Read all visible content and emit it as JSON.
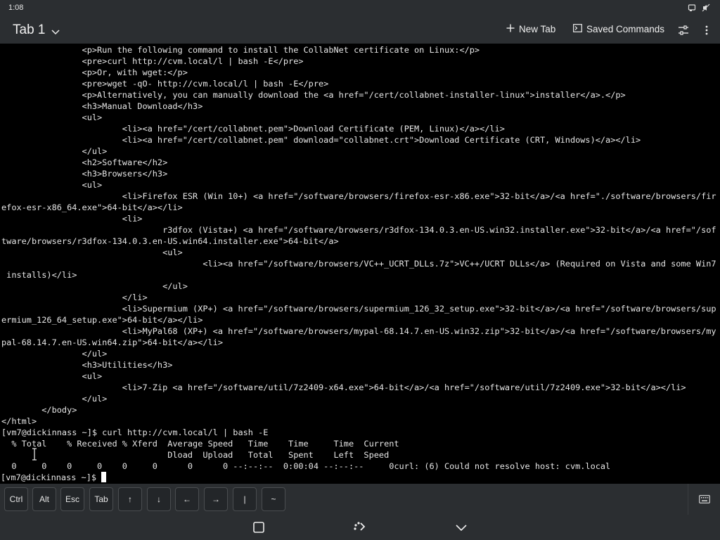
{
  "status_bar": {
    "time": "1:08",
    "icons": [
      "cast-icon",
      "mute-icon"
    ]
  },
  "header": {
    "tab_title": "Tab 1",
    "new_tab_label": "New Tab",
    "saved_commands_label": "Saved Commands"
  },
  "terminal": {
    "lines": [
      "                <p>Run the following command to install the CollabNet certificate on Linux:</p>",
      "                <pre>curl http://cvm.local/l | bash -E</pre>",
      "                <p>Or, with wget:</p>",
      "                <pre>wget -qO- http://cvm.local/l | bash -E</pre>",
      "                <p>Alternatively, you can manually download the <a href=\"/cert/collabnet-installer-linux\">installer</a>.</p>",
      "                <h3>Manual Download</h3>",
      "                <ul>",
      "                        <li><a href=\"/cert/collabnet.pem\">Download Certificate (PEM, Linux)</a></li>",
      "                        <li><a href=\"/cert/collabnet.pem\" download=\"collabnet.crt\">Download Certificate (CRT, Windows)</a></li>",
      "                </ul>",
      "                <h2>Software</h2>",
      "                <h3>Browsers</h3>",
      "                <ul>",
      "                        <li>Firefox ESR (Win 10+) <a href=\"/software/browsers/firefox-esr-x86.exe\">32-bit</a>/<a href=\"./software/browsers/fir",
      "efox-esr-x86_64.exe\">64-bit</a></li>",
      "                        <li>",
      "                                r3dfox (Vista+) <a href=\"/software/browsers/r3dfox-134.0.3.en-US.win32.installer.exe\">32-bit</a>/<a href=\"/sof",
      "tware/browsers/r3dfox-134.0.3.en-US.win64.installer.exe\">64-bit</a>",
      "                                <ul>",
      "                                        <li><a href=\"/software/browsers/VC++_UCRT_DLLs.7z\">VC++/UCRT DLLs</a> (Required on Vista and some Win7",
      " installs)</li>",
      "                                </ul>",
      "                        </li>",
      "                        <li>Supermium (XP+) <a href=\"/software/browsers/supermium_126_32_setup.exe\">32-bit</a>/<a href=\"/software/browsers/sup",
      "ermium_126_64_setup.exe\">64-bit</a></li>",
      "                        <li>MyPal68 (XP+) <a href=\"/software/browsers/mypal-68.14.7.en-US.win32.zip\">32-bit</a>/<a href=\"/software/browsers/my",
      "pal-68.14.7.en-US.win64.zip\">64-bit</a></li>",
      "                </ul>",
      "                <h3>Utilities</h3>",
      "                <ul>",
      "                        <li>7-Zip <a href=\"/software/util/7z2409-x64.exe\">64-bit</a>/<a href=\"/software/util/7z2409.exe\">32-bit</a></li>",
      "                </ul>",
      "        </body>",
      "</html>",
      "[vm7@dickinnass ~]$ curl http://cvm.local/l | bash -E",
      "  % Total    % Received % Xferd  Average Speed   Time    Time     Time  Current",
      "                                 Dload  Upload   Total   Spent    Left  Speed",
      "  0     0    0     0    0     0      0      0 --:--:--  0:00:04 --:--:--     0curl: (6) Could not resolve host: cvm.local"
    ],
    "prompt": "[vm7@dickinnass ~]$ "
  },
  "keys": [
    "Ctrl",
    "Alt",
    "Esc",
    "Tab",
    "↑",
    "↓",
    "←",
    "→",
    "|",
    "~"
  ]
}
